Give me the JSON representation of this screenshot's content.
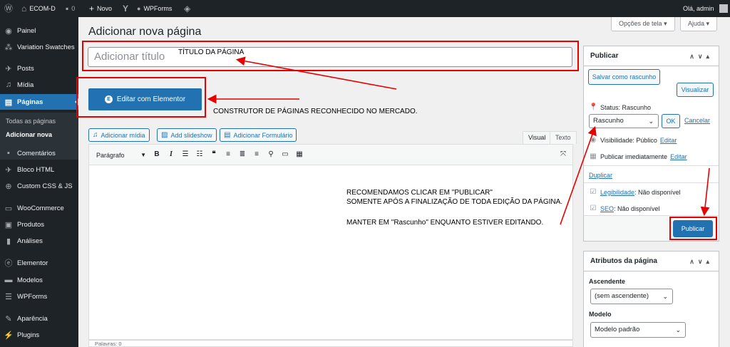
{
  "adminbar": {
    "site_name": "ECOM-D",
    "comments_count": "0",
    "new_label": "Novo",
    "wpforms_label": "WPForms",
    "greeting": "Olá, admin"
  },
  "sidebar": {
    "items": [
      {
        "label": "Painel",
        "icon": "dashboard-icon"
      },
      {
        "label": "Variation Swatches",
        "icon": "swatches-icon"
      },
      {
        "label": "Posts",
        "icon": "pin-icon"
      },
      {
        "label": "Mídia",
        "icon": "media-icon"
      },
      {
        "label": "Páginas",
        "icon": "pages-icon"
      },
      {
        "label": "Comentários",
        "icon": "comments-icon"
      },
      {
        "label": "Bloco HTML",
        "icon": "pin-icon"
      },
      {
        "label": "Custom CSS & JS",
        "icon": "plus-circle-icon"
      },
      {
        "label": "WooCommerce",
        "icon": "woo-icon"
      },
      {
        "label": "Produtos",
        "icon": "archive-icon"
      },
      {
        "label": "Análises",
        "icon": "chart-icon"
      },
      {
        "label": "Elementor",
        "icon": "elementor-icon"
      },
      {
        "label": "Modelos",
        "icon": "folder-icon"
      },
      {
        "label": "WPForms",
        "icon": "form-icon"
      },
      {
        "label": "Aparência",
        "icon": "brush-icon"
      },
      {
        "label": "Plugins",
        "icon": "plug-icon"
      }
    ],
    "submenu": [
      "Todas as páginas",
      "Adicionar nova"
    ]
  },
  "screen_options": {
    "screen_label": "Opções de tela",
    "help_label": "Ajuda"
  },
  "page": {
    "title": "Adicionar nova página",
    "title_placeholder": "Adicionar título",
    "elementor_button": "Editar com Elementor"
  },
  "editor": {
    "add_media": "Adicionar mídia",
    "add_slideshow": "Add slideshow",
    "add_form": "Adicionar Formulário",
    "tab_visual": "Visual",
    "tab_text": "Texto",
    "format": "Parágrafo",
    "word_count": "Palavras: 0"
  },
  "annotations": {
    "title_note": "TÍTULO DA PÁGINA",
    "builder_note": "CONSTRUTOR DE PÁGINAS RECONHECIDO NO MERCADO.",
    "publish_note_1": "RECOMENDAMOS CLICAR EM \"PUBLICAR\"",
    "publish_note_2": "SOMENTE APÓS A FINALIZAÇÃO DE TODA EDIÇÃO DA PÁGINA.",
    "draft_note": "MANTER EM \"Rascunho\" ENQUANTO ESTIVER EDITANDO."
  },
  "publish_box": {
    "title": "Publicar",
    "save_draft": "Salvar como rascunho",
    "preview": "Visualizar",
    "status": "Status: Rascunho",
    "status_value": "Rascunho",
    "ok": "OK",
    "cancel": "Cancelar",
    "visibility": "Visibilidade: Público",
    "visibility_edit": "Editar",
    "publish_time": "Publicar imediatamente",
    "publish_time_edit": "Editar",
    "duplicate": "Duplicar",
    "readability_label": "Legibilidade",
    "readability_value": ": Não disponível",
    "seo_label": "SEO",
    "seo_value": ": Não disponível",
    "publish_button": "Publicar"
  },
  "attributes_box": {
    "title": "Atributos da página",
    "parent_label": "Ascendente",
    "parent_value": "(sem ascendente)",
    "template_label": "Modelo",
    "template_value": "Modelo padrão"
  },
  "colors": {
    "accent": "#2271b1",
    "annotation_red": "#e60000",
    "admin_dark": "#1d2327"
  }
}
